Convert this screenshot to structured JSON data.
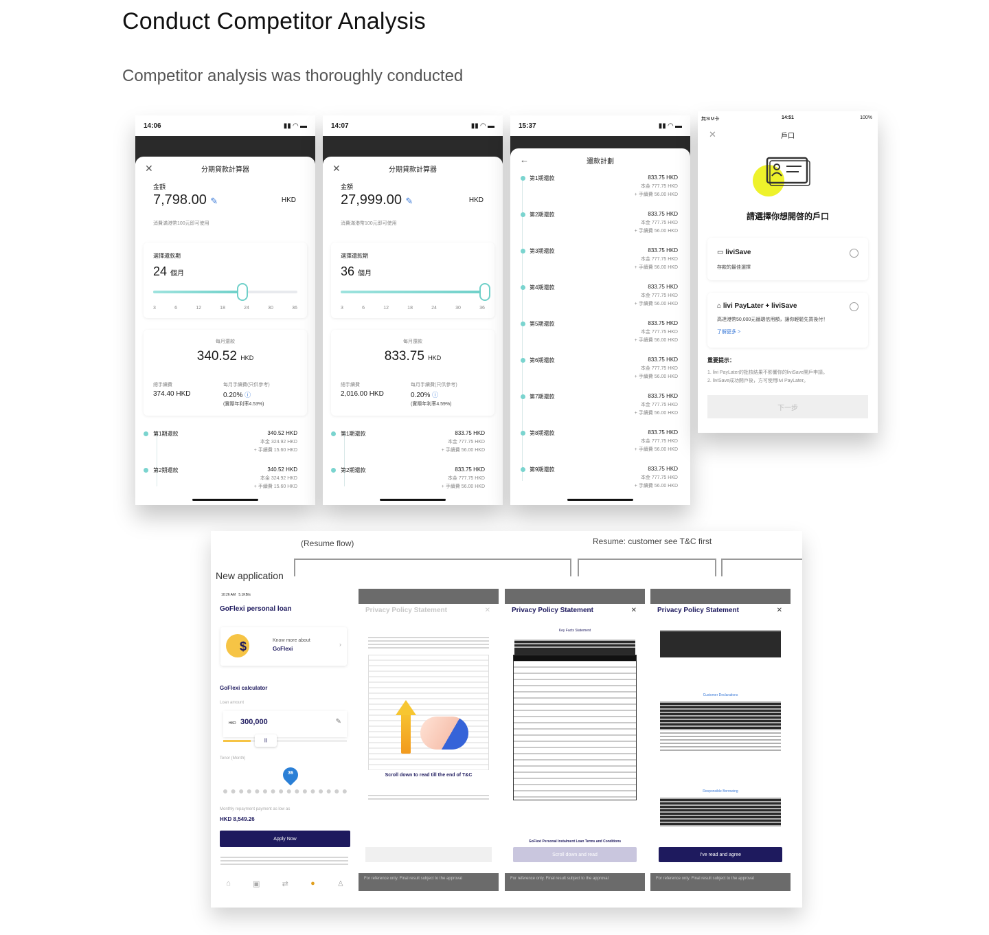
{
  "header": {
    "title": "Conduct Competitor Analysis",
    "subtitle": "Competitor analysis was thoroughly conducted"
  },
  "phone1": {
    "time": "14:06",
    "sheet_title": "分期貸款計算器",
    "amount_label": "金額",
    "amount": "7,798.00",
    "currency": "HKD",
    "note": "消費滿港幣100元即可使用",
    "term_label": "選擇還款期",
    "term_value": "24",
    "term_unit": "個月",
    "term_fraction": 0.62,
    "ticks": [
      "3",
      "6",
      "12",
      "18",
      "24",
      "30",
      "36"
    ],
    "monthly_label": "每月還款",
    "monthly": "340.52",
    "monthly_unit": "HKD",
    "fee_total_label": "總手續費",
    "fee_total": "374.40 HKD",
    "fee_rate_label": "每月手續費(只供參考)",
    "fee_rate": "0.20%",
    "apr": "(實際年利率4.53%)",
    "rows": [
      {
        "label": "第1期還款",
        "amount": "340.52 HKD",
        "principal": "本金 324.92 HKD",
        "fee": "+ 手續費 15.60 HKD"
      },
      {
        "label": "第2期還款",
        "amount": "340.52 HKD",
        "principal": "本金 324.92 HKD",
        "fee": "+ 手續費 15.60 HKD"
      }
    ]
  },
  "phone2": {
    "time": "14:07",
    "sheet_title": "分期貸款計算器",
    "amount_label": "金額",
    "amount": "27,999.00",
    "currency": "HKD",
    "note": "消費滿港幣100元即可使用",
    "term_label": "選擇還款期",
    "term_value": "36",
    "term_unit": "個月",
    "term_fraction": 1.0,
    "ticks": [
      "3",
      "6",
      "12",
      "18",
      "24",
      "30",
      "36"
    ],
    "monthly_label": "每月還款",
    "monthly": "833.75",
    "monthly_unit": "HKD",
    "fee_total_label": "總手續費",
    "fee_total": "2,016.00 HKD",
    "fee_rate_label": "每月手續費(只供參考)",
    "fee_rate": "0.20%",
    "apr": "(實際年利率4.59%)",
    "rows": [
      {
        "label": "第1期還款",
        "amount": "833.75 HKD",
        "principal": "本金 777.75 HKD",
        "fee": "+ 手續費 56.00 HKD"
      },
      {
        "label": "第2期還款",
        "amount": "833.75 HKD",
        "principal": "本金 777.75 HKD",
        "fee": "+ 手續費 56.00 HKD"
      }
    ]
  },
  "phone3": {
    "time": "15:37",
    "sheet_title": "還款計劃",
    "rows": [
      {
        "label": "第1期還款",
        "amount": "833.75 HKD",
        "principal": "本金 777.75 HKD",
        "fee": "+ 手續費 56.00 HKD"
      },
      {
        "label": "第2期還款",
        "amount": "833.75 HKD",
        "principal": "本金 777.75 HKD",
        "fee": "+ 手續費 56.00 HKD"
      },
      {
        "label": "第3期還款",
        "amount": "833.75 HKD",
        "principal": "本金 777.75 HKD",
        "fee": "+ 手續費 56.00 HKD"
      },
      {
        "label": "第4期還款",
        "amount": "833.75 HKD",
        "principal": "本金 777.75 HKD",
        "fee": "+ 手續費 56.00 HKD"
      },
      {
        "label": "第5期還款",
        "amount": "833.75 HKD",
        "principal": "本金 777.75 HKD",
        "fee": "+ 手續費 56.00 HKD"
      },
      {
        "label": "第6期還款",
        "amount": "833.75 HKD",
        "principal": "本金 777.75 HKD",
        "fee": "+ 手續費 56.00 HKD"
      },
      {
        "label": "第7期還款",
        "amount": "833.75 HKD",
        "principal": "本金 777.75 HKD",
        "fee": "+ 手續費 56.00 HKD"
      },
      {
        "label": "第8期還款",
        "amount": "833.75 HKD",
        "principal": "本金 777.75 HKD",
        "fee": "+ 手續費 56.00 HKD"
      },
      {
        "label": "第9期還款",
        "amount": "833.75 HKD",
        "principal": "本金 777.75 HKD",
        "fee": "+ 手續費 56.00 HKD"
      }
    ]
  },
  "phone4": {
    "carrier": "無SIM卡",
    "time": "14:51",
    "battery": "100%",
    "title": "戶口",
    "heading": "請選擇你想開啓的戶口",
    "option1_title": "liviSave",
    "option1_desc": "存款的最佳選擇",
    "option2_title": "livi PayLater + liviSave",
    "option2_desc": "高達港幣50,000元循環信用額，讓你輕鬆先買後付！",
    "option2_link": "了解更多 >",
    "notice_title": "重要提示：",
    "notice1": "1. livi PayLater的批核結果不影響你的liviSave開戶申請。",
    "notice2": "2. liviSave成功開戶後，方可使用livi PayLater。",
    "next_button": "下一步"
  },
  "flow": {
    "resume_flow_label": "(Resume flow)",
    "resume_tc_label": "Resume: customer see T&C first",
    "new_app_label": "New application",
    "app": {
      "time": "10:26 AM",
      "speed": "5.1KB/s",
      "title": "GoFlexi personal loan",
      "banner_line1": "Know more about",
      "banner_line2": "GoFlexi",
      "calc_title": "GoFlexi calculator",
      "loan_amount_label": "Loan amount",
      "currency": "HKD",
      "loan_amount": "300,000",
      "tenor_label": "Tenor (Month)",
      "tenor_value": "36",
      "repayment_label": "Monthly repayment payment as low as",
      "repayment": "HKD 8,549.26",
      "apply_button": "Apply Now"
    },
    "screens": [
      {
        "title": "Privacy Policy Statement",
        "subtitle": "",
        "scroll_hint": "Scroll down to read till the end of T&C",
        "bottom": "For reference only. Final result subject to the approval"
      },
      {
        "title": "Privacy Policy Statement",
        "subtitle": "Key Facts Statement",
        "section": "GoFlexi Personal Instalment Loan Terms and Conditions",
        "button": "Scroll down and read",
        "bottom": "For reference only. Final result subject to the approval"
      },
      {
        "title": "Privacy Policy Statement",
        "subtitle": "Customer Declarations",
        "section2": "Responsible Borrowing",
        "button": "I've read and agree",
        "bottom": "For reference only. Final result subject to the approval"
      }
    ]
  },
  "colors": {
    "teal": "#6fd0c9",
    "navy": "#1e1a5e",
    "livi_yellow": "#eef22b",
    "grey_bar": "#6b6b6b"
  }
}
